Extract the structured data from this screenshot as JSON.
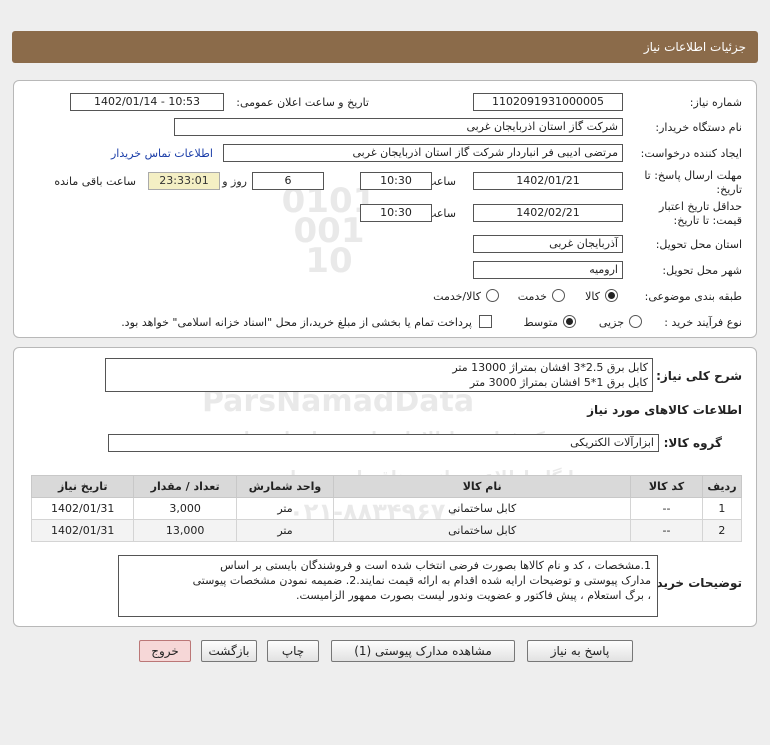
{
  "header": {
    "title": "جزئیات اطلاعات نیاز"
  },
  "form": {
    "need_number_label": "شماره نیاز:",
    "need_number": "1102091931000005",
    "announce_label": "تاریخ و ساعت اعلان عمومی:",
    "announce_value": "1402/01/14 - 10:53",
    "buyer_org_label": "نام دستگاه خریدار:",
    "buyer_org": "شرکت گاز استان اذربایجان غربی",
    "requester_label": "ایجاد کننده درخواست:",
    "requester": "مرتضی ادیبی فر انباردار شرکت گاز استان اذربایجان غربی",
    "contact_link": "اطلاعات تماس خریدار",
    "deadline_label_1": "مهلت ارسال پاسخ: تا",
    "deadline_label_2": "تاریخ:",
    "deadline_date": "1402/01/21",
    "time_label": "ساعت",
    "deadline_time": "10:30",
    "days_value": "6",
    "days_label": "روز و",
    "remaining_time": "23:33:01",
    "remaining_label": "ساعت باقی مانده",
    "validity_label_1": "حداقل تاریخ اعتبار",
    "validity_label_2": "قیمت: تا تاریخ:",
    "validity_date": "1402/02/21",
    "validity_time": "10:30",
    "province_label": "استان محل تحویل:",
    "province": "آذربایجان غربی",
    "city_label": "شهر محل تحویل:",
    "city": "ارومیه",
    "category_label": "طبقه بندی موضوعی:",
    "category_options": [
      "کالا",
      "خدمت",
      "کالا/خدمت"
    ],
    "process_label": "نوع فرآیند خرید :",
    "process_options": [
      "جزیی",
      "متوسط"
    ],
    "payment_note": "پرداخت تمام یا بخشی از مبلغ خرید،از محل \"اسناد خزانه اسلامی\" خواهد بود."
  },
  "summary": {
    "label": "شرح کلی نیاز:",
    "line1": "کابل برق 2.5*3 افشان بمتراژ 13000 متر",
    "line2": "کابل برق 1*5 افشان بمتراژ 3000 متر"
  },
  "goods": {
    "section_title": "اطلاعات کالاهای مورد نیاز",
    "group_label": "گروه کالا:",
    "group_value": "ابزارآلات الکتریکی",
    "columns": [
      "ردیف",
      "کد کالا",
      "نام کالا",
      "واحد شمارش",
      "تعداد / مقدار",
      "تاریخ نیاز"
    ],
    "rows": [
      {
        "idx": "1",
        "code": "--",
        "name": "کابل ساختمانی",
        "unit": "متر",
        "qty": "3,000",
        "date": "1402/01/31"
      },
      {
        "idx": "2",
        "code": "--",
        "name": "کابل ساختمانی",
        "unit": "متر",
        "qty": "13,000",
        "date": "1402/01/31"
      }
    ]
  },
  "notes": {
    "label": "توضیحات خریدار:",
    "line1": "1.مشخصات ، کد و نام کالاها بصورت فرضی انتخاب شده است و فروشندگان بایستی بر اساس",
    "line2": "مدارک پیوستی و توضیحات ارایه شده اقدام به ارائه قیمت نمایند.2. ضمیمه نمودن مشخصات پیوستی",
    "line3": "، برگ استعلام ، پیش فاکتور و عضویت وندور لیست بصورت ممهور الزامیست."
  },
  "buttons": {
    "reply": "پاسخ به نیاز",
    "attachments": "مشاهده مدارک پیوستی (1)",
    "print": "چاپ",
    "back": "بازگشت",
    "exit": "خروج"
  },
  "watermark": {
    "brand": "ParsNamadData",
    "line1": "مرکز فراوری اطلاعات پارس نماد داده ها",
    "line2": "پایگاه اطلاع رسانی مناقصات و مزایده",
    "phone": "۰۲۱-۸۸۳۴۹۶۷۰",
    "number": "0101 001 10"
  },
  "colors": {
    "title_bar": "#8b6b4a",
    "table_header": "#d9d9d9",
    "link": "#1a3da8",
    "exit_button": "#f6d7d7"
  }
}
